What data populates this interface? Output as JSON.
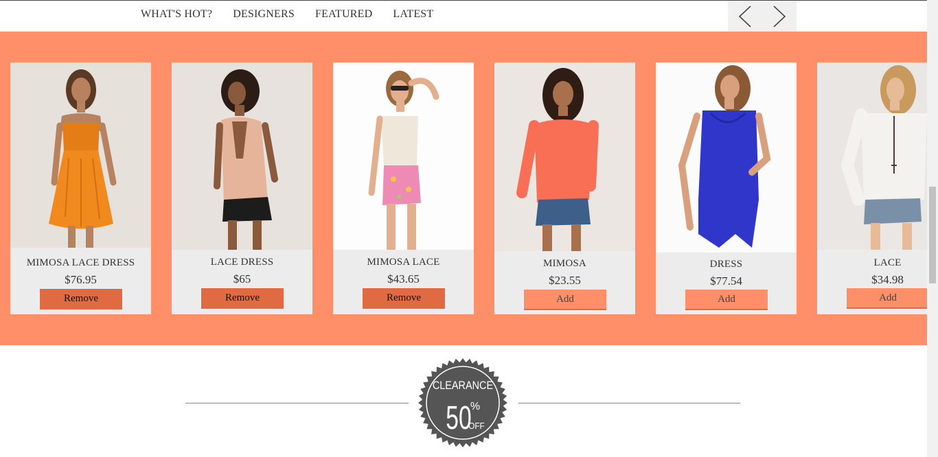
{
  "nav": {
    "links": [
      "WHAT'S HOT?",
      "DESIGNERS",
      "FEATURED",
      "LATEST"
    ]
  },
  "carousel": {
    "products": [
      {
        "name": "MIMOSA LACE DRESS",
        "price": "$76.95",
        "action": "Remove",
        "in_cart": true
      },
      {
        "name": "LACE DRESS",
        "price": "$65",
        "action": "Remove",
        "in_cart": true
      },
      {
        "name": "MIMOSA LACE",
        "price": "$43.65",
        "action": "Remove",
        "in_cart": true
      },
      {
        "name": "MIMOSA",
        "price": "$23.55",
        "action": "Add",
        "in_cart": false
      },
      {
        "name": "DRESS",
        "price": "$77.54",
        "action": "Add",
        "in_cart": false
      },
      {
        "name": "LACE",
        "price": "$34.98",
        "action": "Add",
        "in_cart": false
      }
    ]
  },
  "clearance": {
    "line1": "CLEARANCE",
    "big": "50",
    "pct": "%",
    "off": "OFF"
  },
  "colors": {
    "band": "#fe8f68",
    "remove": "#e06a41",
    "card": "#ececec",
    "badge": "#555555"
  }
}
